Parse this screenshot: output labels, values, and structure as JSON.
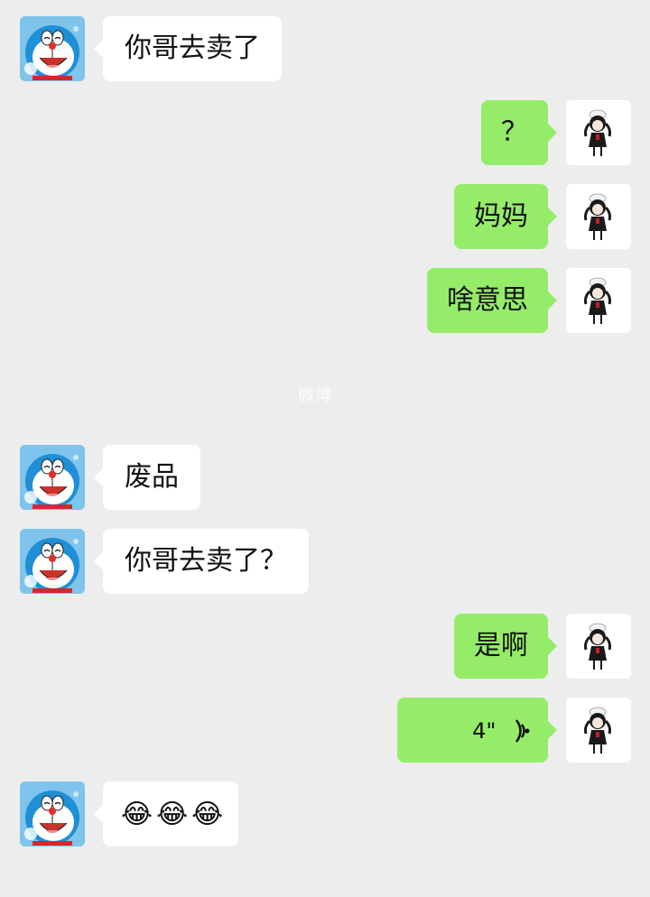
{
  "colors": {
    "background": "#ededed",
    "incoming_bubble": "#ffffff",
    "outgoing_bubble": "#95ec69"
  },
  "contact_avatar_icon": "doraemon-avatar-icon",
  "self_avatar_icon": "chibi-girl-avatar-icon",
  "watermark": "微博",
  "messages": [
    {
      "side": "left",
      "text": "你哥去卖了"
    },
    {
      "side": "right",
      "text": "？"
    },
    {
      "side": "right",
      "text": "妈妈"
    },
    {
      "side": "right",
      "text": "啥意思"
    },
    {
      "side": "left",
      "text": "废品"
    },
    {
      "side": "left",
      "text": "你哥去卖了？"
    },
    {
      "side": "right",
      "text": "是啊"
    },
    {
      "side": "right",
      "type": "voice",
      "duration": "4\""
    },
    {
      "side": "left",
      "type": "emoji",
      "emoji": [
        "😂",
        "😂",
        "😂"
      ],
      "emoji_name": "face-with-tears-of-joy-icon"
    }
  ]
}
